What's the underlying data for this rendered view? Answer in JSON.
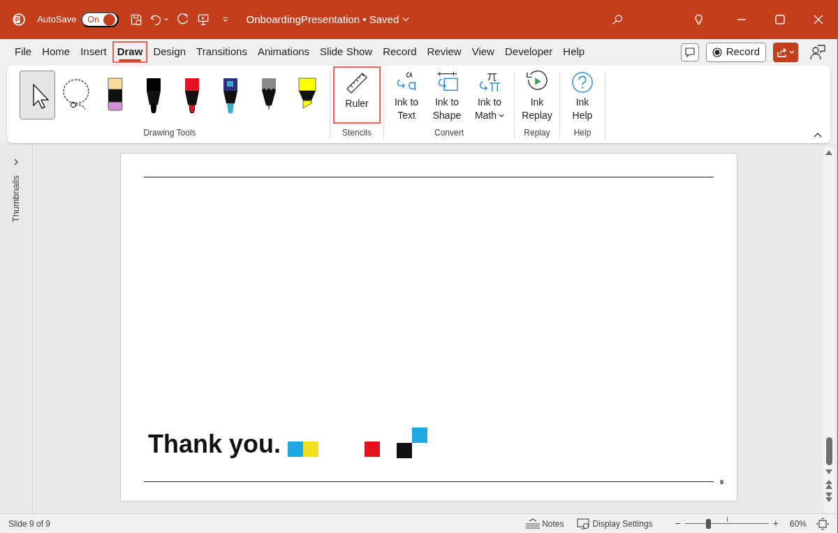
{
  "title_bar": {
    "autosave_label": "AutoSave",
    "autosave": {
      "on": true,
      "label": "On"
    },
    "document_title": "OnboardingPresentation • Saved"
  },
  "tabs": [
    {
      "label": "File",
      "selected": false,
      "highlighted": false
    },
    {
      "label": "Home",
      "selected": false,
      "highlighted": false
    },
    {
      "label": "Insert",
      "selected": false,
      "highlighted": false
    },
    {
      "label": "Draw",
      "selected": true,
      "highlighted": true
    },
    {
      "label": "Design",
      "selected": false,
      "highlighted": false
    },
    {
      "label": "Transitions",
      "selected": false,
      "highlighted": false
    },
    {
      "label": "Animations",
      "selected": false,
      "highlighted": false
    },
    {
      "label": "Slide Show",
      "selected": false,
      "highlighted": false
    },
    {
      "label": "Record",
      "selected": false,
      "highlighted": false
    },
    {
      "label": "Review",
      "selected": false,
      "highlighted": false
    },
    {
      "label": "View",
      "selected": false,
      "highlighted": false
    },
    {
      "label": "Developer",
      "selected": false,
      "highlighted": false
    },
    {
      "label": "Help",
      "selected": false,
      "highlighted": false
    }
  ],
  "record_button": "Record",
  "drawing_tools": {
    "label": "Drawing Tools",
    "tools": [
      {
        "kind": "select",
        "selected": true
      },
      {
        "kind": "lasso",
        "selected": false
      },
      {
        "kind": "eraser",
        "selected": false
      },
      {
        "kind": "pen",
        "selected": false,
        "color": "#000000"
      },
      {
        "kind": "pen",
        "selected": false,
        "color": "#e81123"
      },
      {
        "kind": "galaxy",
        "selected": false,
        "color": "#3fa9c9"
      },
      {
        "kind": "pencil",
        "selected": false,
        "color": "#8a8a8a"
      },
      {
        "kind": "highlighter",
        "selected": false,
        "color": "#ffff00"
      }
    ]
  },
  "groups": [
    {
      "label": "Stencils",
      "buttons": [
        {
          "kind": "ruler",
          "label": "Ruler",
          "highlighted": true
        }
      ]
    },
    {
      "label": "Convert",
      "buttons": [
        {
          "kind": "ink-to-text",
          "label": "Ink to Text",
          "highlighted": false
        },
        {
          "kind": "ink-to-shape",
          "label": "Ink to Shape",
          "highlighted": false
        },
        {
          "kind": "ink-to-math",
          "label": "Ink to Math",
          "highlighted": false,
          "dropdown": true
        }
      ]
    },
    {
      "label": "Replay",
      "buttons": [
        {
          "kind": "ink-replay",
          "label": "Ink Replay",
          "highlighted": false
        }
      ]
    },
    {
      "label": "Help",
      "buttons": [
        {
          "kind": "ink-help",
          "label": "Ink Help",
          "highlighted": false
        }
      ]
    }
  ],
  "thumbnails_label": "Thumbnails",
  "slide": {
    "title": "Thank you.",
    "page_number": "9"
  },
  "status_bar": {
    "slide_info": "Slide 9 of 9",
    "notes": "Notes",
    "display_settings": "Display Settings",
    "zoom_out": "−",
    "zoom_in": "+",
    "zoom": {
      "level": 0.28
    },
    "zoom_percent": "60%"
  }
}
